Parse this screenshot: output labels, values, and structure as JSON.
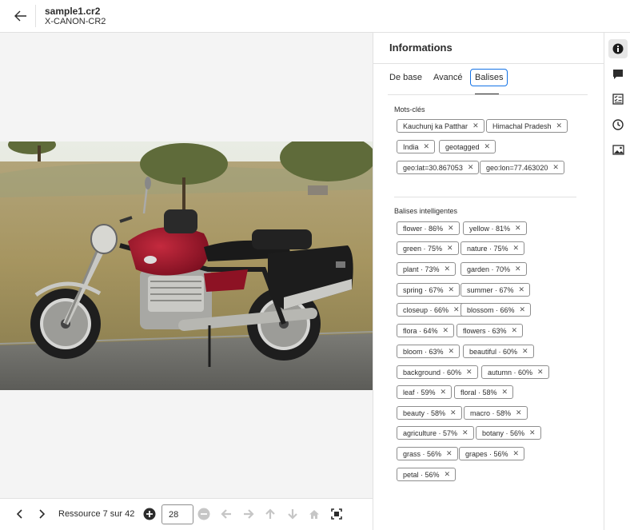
{
  "header": {
    "file_name": "sample1.cr2",
    "file_type": "X-CANON-CR2"
  },
  "toolbar": {
    "resource_label": "Ressource 7 sur 42",
    "page_value": "28"
  },
  "panel": {
    "title": "Informations",
    "tabs": [
      {
        "label": "De base"
      },
      {
        "label": "Avancé"
      },
      {
        "label": "Balises"
      }
    ],
    "active_tab": "Balises",
    "keywords_label": "Mots-clés",
    "keywords": [
      {
        "label": "Kauchunj ka Patthar"
      },
      {
        "label": "Himachal Pradesh"
      },
      {
        "label": "India"
      },
      {
        "label": "geotagged"
      },
      {
        "label": "geo:lat=30.867053"
      },
      {
        "label": "geo:lon=77.463020"
      }
    ],
    "smart_tags_label": "Balises intelligentes",
    "smart_tags": [
      {
        "label": "flower · 86%"
      },
      {
        "label": "yellow · 81%"
      },
      {
        "label": "green · 75%"
      },
      {
        "label": "nature · 75%"
      },
      {
        "label": "plant · 73%"
      },
      {
        "label": "garden · 70%"
      },
      {
        "label": "spring · 67%"
      },
      {
        "label": "summer · 67%"
      },
      {
        "label": "closeup · 66%"
      },
      {
        "label": "blossom · 66%"
      },
      {
        "label": "flora · 64%"
      },
      {
        "label": "flowers · 63%"
      },
      {
        "label": "bloom · 63%"
      },
      {
        "label": "beautiful · 60%"
      },
      {
        "label": "background · 60%"
      },
      {
        "label": "autumn · 60%"
      },
      {
        "label": "leaf · 59%"
      },
      {
        "label": "floral · 58%"
      },
      {
        "label": "beauty · 58%"
      },
      {
        "label": "macro · 58%"
      },
      {
        "label": "agriculture · 57%"
      },
      {
        "label": "botany · 56%"
      },
      {
        "label": "grass · 56%"
      },
      {
        "label": "grapes · 56%"
      },
      {
        "label": "petal · 56%"
      }
    ],
    "remove_glyph": "✕"
  },
  "rail": {
    "icons": [
      "info-icon",
      "comment-icon",
      "checklist-icon",
      "history-icon",
      "image-icon"
    ],
    "active": "info-icon"
  },
  "colors": {
    "accent": "#1473e6",
    "motorcycle_red": "#9b1428"
  }
}
